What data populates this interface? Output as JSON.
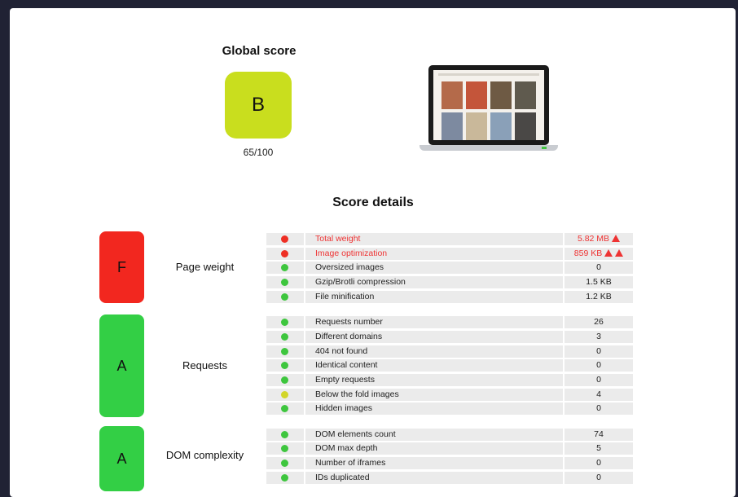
{
  "global": {
    "title": "Global score",
    "grade": "B",
    "grade_color": "#c9de1e",
    "score": "65/100"
  },
  "details_title": "Score details",
  "colors": {
    "good": "#3ec63e",
    "bad": "#ee2f24",
    "warn": "#d2d62a",
    "grade_a": "#33cf45",
    "grade_f": "#f2271f"
  },
  "categories": [
    {
      "grade": "F",
      "label": "Page weight",
      "metrics": [
        {
          "name": "Total weight",
          "value": "5.82 MB",
          "status": "bad",
          "warnings": 1
        },
        {
          "name": "Image optimization",
          "value": "859 KB",
          "status": "bad",
          "warnings": 2
        },
        {
          "name": "Oversized images",
          "value": "0",
          "status": "good"
        },
        {
          "name": "Gzip/Brotli compression",
          "value": "1.5 KB",
          "status": "good"
        },
        {
          "name": "File minification",
          "value": "1.2 KB",
          "status": "good"
        }
      ]
    },
    {
      "grade": "A",
      "label": "Requests",
      "metrics": [
        {
          "name": "Requests number",
          "value": "26",
          "status": "good"
        },
        {
          "name": "Different domains",
          "value": "3",
          "status": "good"
        },
        {
          "name": "404 not found",
          "value": "0",
          "status": "good"
        },
        {
          "name": "Identical content",
          "value": "0",
          "status": "good"
        },
        {
          "name": "Empty requests",
          "value": "0",
          "status": "good"
        },
        {
          "name": "Below the fold images",
          "value": "4",
          "status": "warn"
        },
        {
          "name": "Hidden images",
          "value": "0",
          "status": "good"
        }
      ]
    },
    {
      "grade": "A",
      "label": "DOM complexity",
      "metrics": [
        {
          "name": "DOM elements count",
          "value": "74",
          "status": "good"
        },
        {
          "name": "DOM max depth",
          "value": "5",
          "status": "good"
        },
        {
          "name": "Number of iframes",
          "value": "0",
          "status": "good"
        },
        {
          "name": "IDs duplicated",
          "value": "0",
          "status": "good"
        }
      ]
    }
  ]
}
